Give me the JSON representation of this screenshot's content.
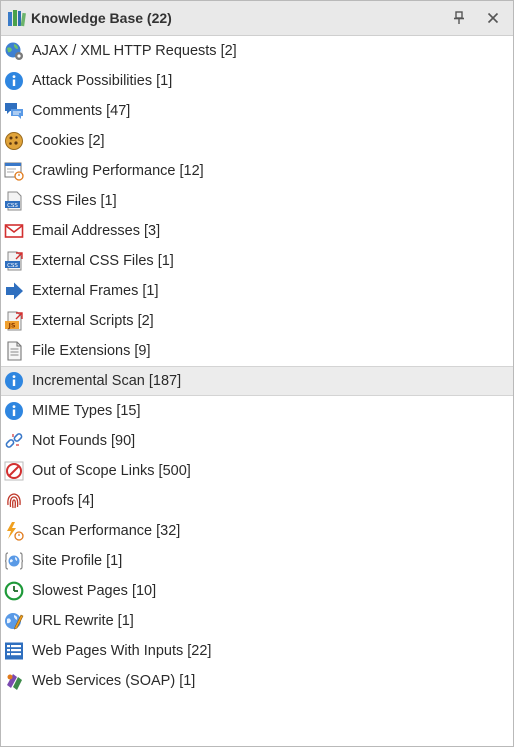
{
  "window": {
    "title": "Knowledge Base (22)"
  },
  "items": [
    {
      "label": "AJAX / XML HTTP Requests [2]",
      "icon": "globe-gear-icon"
    },
    {
      "label": "Attack Possibilities [1]",
      "icon": "info-icon"
    },
    {
      "label": "Comments [47]",
      "icon": "comments-icon"
    },
    {
      "label": "Cookies [2]",
      "icon": "cookie-icon"
    },
    {
      "label": "Crawling Performance [12]",
      "icon": "performance-chart-icon"
    },
    {
      "label": "CSS Files [1]",
      "icon": "css-file-icon"
    },
    {
      "label": "Email Addresses [3]",
      "icon": "envelope-icon"
    },
    {
      "label": "External CSS Files [1]",
      "icon": "external-css-icon"
    },
    {
      "label": "External Frames [1]",
      "icon": "arrow-right-icon"
    },
    {
      "label": "External Scripts [2]",
      "icon": "external-js-icon"
    },
    {
      "label": "File Extensions [9]",
      "icon": "document-icon"
    },
    {
      "label": "Incremental Scan [187]",
      "icon": "info-icon"
    },
    {
      "label": "MIME Types [15]",
      "icon": "info-icon"
    },
    {
      "label": "Not Founds [90]",
      "icon": "broken-link-icon"
    },
    {
      "label": "Out of Scope Links [500]",
      "icon": "prohibited-icon"
    },
    {
      "label": "Proofs [4]",
      "icon": "fingerprint-icon"
    },
    {
      "label": "Scan Performance [32]",
      "icon": "lightning-timer-icon"
    },
    {
      "label": "Site Profile [1]",
      "icon": "globe-braces-icon"
    },
    {
      "label": "Slowest Pages [10]",
      "icon": "clock-icon"
    },
    {
      "label": "URL Rewrite [1]",
      "icon": "globe-pencil-icon"
    },
    {
      "label": "Web Pages With Inputs [22]",
      "icon": "form-list-icon"
    },
    {
      "label": "Web Services (SOAP) [1]",
      "icon": "soap-services-icon"
    }
  ],
  "selected_index": 11,
  "colors": {
    "selected_bg": "#ececec",
    "titlebar_bg": "#e9e9e9",
    "info_blue": "#2f86e0"
  }
}
